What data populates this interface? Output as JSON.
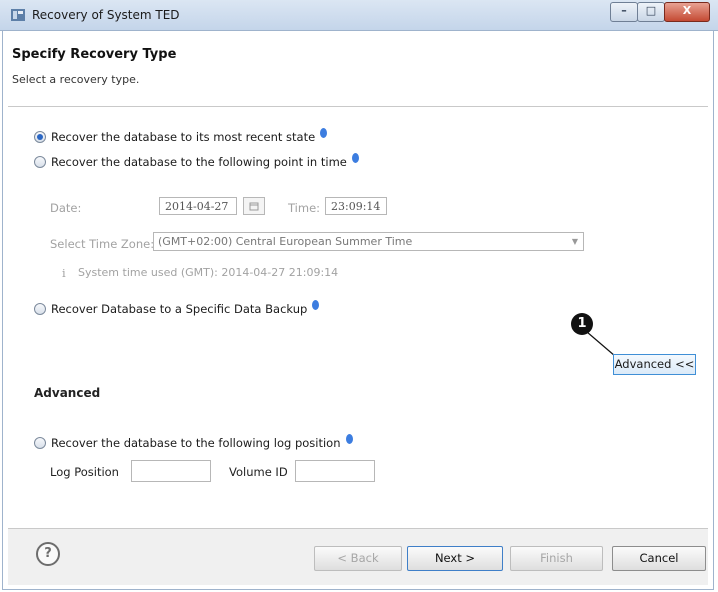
{
  "window": {
    "title": "Recovery of System TED",
    "controls": {
      "minimize": "–",
      "maximize": "□",
      "close": "X"
    }
  },
  "header": {
    "title": "Specify Recovery Type",
    "subtitle": "Select a recovery type."
  },
  "options": {
    "most_recent": "Recover the database to its most recent state",
    "point_in_time": "Recover the database to the following point in time",
    "specific_backup": "Recover Database to a Specific Data Backup",
    "log_position": "Recover the database to the following log position"
  },
  "point_in_time": {
    "date_label": "Date:",
    "date_value": "2014-04-27",
    "time_label": "Time:",
    "time_value": "23:09:14",
    "timezone_label": "Select Time Zone:",
    "timezone_value": "(GMT+02:00) Central European Summer Time",
    "info_icon": "i",
    "system_time_note": "System time used (GMT): 2014-04-27 21:09:14"
  },
  "advanced": {
    "toggle_label": "Advanced <<",
    "callout_number": "1",
    "section_title": "Advanced",
    "log_position_label": "Log Position",
    "log_position_value": "",
    "volume_id_label": "Volume ID",
    "volume_id_value": ""
  },
  "footer": {
    "help": "?",
    "back": "< Back",
    "next": "Next >",
    "finish": "Finish",
    "cancel": "Cancel"
  },
  "colors": {
    "accent": "#2b67c4",
    "info": "#3c7de0",
    "muted_text": "#a2a2a2"
  }
}
